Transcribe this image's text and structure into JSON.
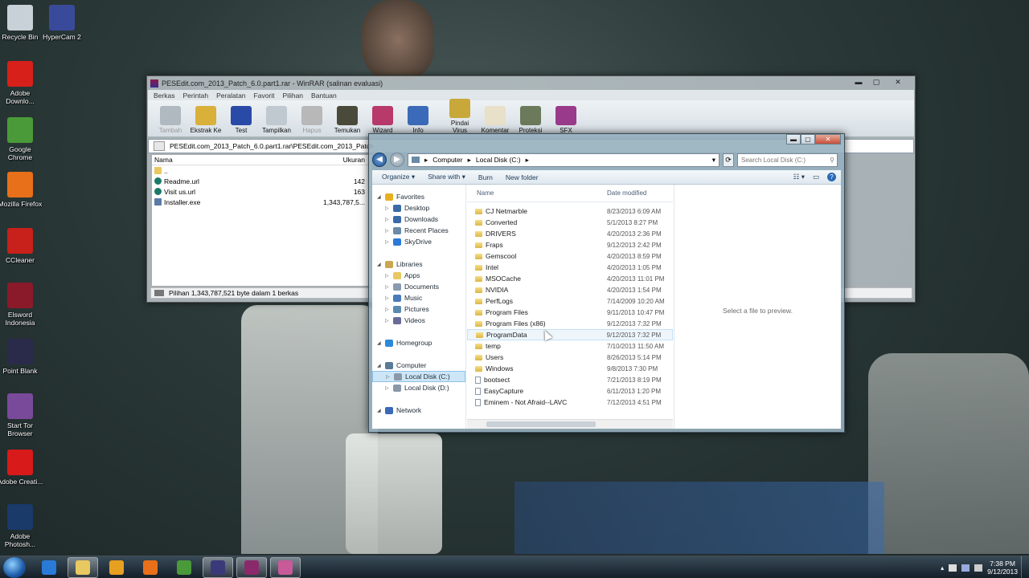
{
  "desktop": {
    "icons": [
      {
        "label": "Recycle Bin",
        "color": "#c8d0d8"
      },
      {
        "label": "HyperCam 2",
        "color": "#3a4a9a"
      },
      {
        "label": "Adobe Downlo...",
        "color": "#d8201a"
      },
      {
        "label": "Google Chrome",
        "color": "#4a9a3a"
      },
      {
        "label": "Mozilla Firefox",
        "color": "#e8701a"
      },
      {
        "label": "CCleaner",
        "color": "#c8201a"
      },
      {
        "label": "Elsword Indonesia",
        "color": "#8a1a2a"
      },
      {
        "label": "Point Blank",
        "color": "#2a2a4a"
      },
      {
        "label": "Start Tor Browser",
        "color": "#7a4a9a"
      },
      {
        "label": "Adobe Creati...",
        "color": "#d81a1a"
      },
      {
        "label": "Adobe Photosh...",
        "color": "#1a3a6a"
      }
    ]
  },
  "winrar": {
    "title": "PESEdit.com_2013_Patch_6.0.part1.rar - WinRAR (salinan evaluasi)",
    "menu": [
      "Berkas",
      "Perintah",
      "Peralatan",
      "Favorit",
      "Pilihan",
      "Bantuan"
    ],
    "toolbar": [
      {
        "label": "Tambah",
        "disabled": true,
        "icon": "add-archive-icon",
        "color": "#b0b8c0"
      },
      {
        "label": "Ekstrak Ke",
        "disabled": false,
        "icon": "extract-icon",
        "color": "#d8b03a"
      },
      {
        "label": "Test",
        "disabled": false,
        "icon": "test-icon",
        "color": "#2a4aa8"
      },
      {
        "label": "Tampilkan",
        "disabled": false,
        "icon": "view-icon",
        "color": "#c0c8d0"
      },
      {
        "label": "Hapus",
        "disabled": true,
        "icon": "delete-icon",
        "color": "#b8b8b8"
      },
      {
        "label": "Temukan",
        "disabled": false,
        "icon": "find-icon",
        "color": "#4a4a3a"
      },
      {
        "label": "Wizard",
        "disabled": false,
        "icon": "wizard-icon",
        "color": "#b83a6a"
      },
      {
        "label": "Info",
        "disabled": false,
        "icon": "info-icon",
        "color": "#3a6ab8"
      },
      {
        "label": "Pindai Virus",
        "disabled": false,
        "icon": "virus-scan-icon",
        "color": "#c8a83a"
      },
      {
        "label": "Komentar",
        "disabled": false,
        "icon": "comment-icon",
        "color": "#e8e0c8"
      },
      {
        "label": "Proteksi",
        "disabled": false,
        "icon": "protect-icon",
        "color": "#6a7a5a"
      },
      {
        "label": "SFX",
        "disabled": false,
        "icon": "sfx-icon",
        "color": "#9a3a8a"
      }
    ],
    "path": "PESEdit.com_2013_Patch_6.0.part1.rar\\PESEdit.com_2013_Patch",
    "columns": {
      "name": "Nama",
      "size": "Ukuran"
    },
    "files": [
      {
        "name": "..",
        "size": "",
        "icon": "folder-icon"
      },
      {
        "name": "Readme.url",
        "size": "142",
        "icon": "url-icon"
      },
      {
        "name": "Visit us.url",
        "size": "163",
        "icon": "url-icon"
      },
      {
        "name": "Installer.exe",
        "size": "1,343,787,5...",
        "icon": "exe-icon"
      }
    ],
    "status": "Pilihan 1,343,787,521 byte dalam 1 berkas"
  },
  "explorer": {
    "breadcrumb": [
      "Computer",
      "Local Disk (C:)"
    ],
    "search_placeholder": "Search Local Disk (C:)",
    "commands": [
      "Organize ▾",
      "Share with ▾",
      "Burn",
      "New folder"
    ],
    "nav": [
      {
        "label": "Favorites",
        "level": 0,
        "icon": "star-icon",
        "selected": false
      },
      {
        "label": "Desktop",
        "level": 1,
        "icon": "desktop-icon",
        "selected": false
      },
      {
        "label": "Downloads",
        "level": 1,
        "icon": "downloads-icon",
        "selected": false
      },
      {
        "label": "Recent Places",
        "level": 1,
        "icon": "recent-places-icon",
        "selected": false
      },
      {
        "label": "SkyDrive",
        "level": 1,
        "icon": "skydrive-icon",
        "selected": false
      },
      {
        "label": "",
        "level": -1
      },
      {
        "label": "Libraries",
        "level": 0,
        "icon": "libraries-icon",
        "selected": false
      },
      {
        "label": "Apps",
        "level": 1,
        "icon": "folder-icon",
        "selected": false
      },
      {
        "label": "Documents",
        "level": 1,
        "icon": "documents-icon",
        "selected": false
      },
      {
        "label": "Music",
        "level": 1,
        "icon": "music-icon",
        "selected": false
      },
      {
        "label": "Pictures",
        "level": 1,
        "icon": "pictures-icon",
        "selected": false
      },
      {
        "label": "Videos",
        "level": 1,
        "icon": "videos-icon",
        "selected": false
      },
      {
        "label": "",
        "level": -1
      },
      {
        "label": "Homegroup",
        "level": 0,
        "icon": "homegroup-icon",
        "selected": false
      },
      {
        "label": "",
        "level": -1
      },
      {
        "label": "Computer",
        "level": 0,
        "icon": "computer-icon",
        "selected": false
      },
      {
        "label": "Local Disk (C:)",
        "level": 1,
        "icon": "drive-icon",
        "selected": true
      },
      {
        "label": "Local Disk (D:)",
        "level": 1,
        "icon": "drive-icon",
        "selected": false
      },
      {
        "label": "",
        "level": -1
      },
      {
        "label": "Network",
        "level": 0,
        "icon": "network-icon",
        "selected": false
      }
    ],
    "columns": {
      "name": "Name",
      "date": "Date modified"
    },
    "files": [
      {
        "name": "CJ Netmarble",
        "date": "8/23/2013 6:09 AM",
        "type": "folder"
      },
      {
        "name": "Converted",
        "date": "5/1/2013 8:27 PM",
        "type": "folder"
      },
      {
        "name": "DRIVERS",
        "date": "4/20/2013 2:36 PM",
        "type": "folder"
      },
      {
        "name": "Fraps",
        "date": "9/12/2013 2:42 PM",
        "type": "folder"
      },
      {
        "name": "Gemscool",
        "date": "4/20/2013 8:59 PM",
        "type": "folder"
      },
      {
        "name": "Intel",
        "date": "4/20/2013 1:05 PM",
        "type": "folder"
      },
      {
        "name": "MSOCache",
        "date": "4/20/2013 11:01 PM",
        "type": "folder"
      },
      {
        "name": "NVIDIA",
        "date": "4/20/2013 1:54 PM",
        "type": "folder"
      },
      {
        "name": "PerfLogs",
        "date": "7/14/2009 10:20 AM",
        "type": "folder"
      },
      {
        "name": "Program Files",
        "date": "9/11/2013 10:47 PM",
        "type": "folder"
      },
      {
        "name": "Program Files (x86)",
        "date": "9/12/2013 7:32 PM",
        "type": "folder"
      },
      {
        "name": "ProgramData",
        "date": "9/12/2013 7:32 PM",
        "type": "folder",
        "hover": true
      },
      {
        "name": "temp",
        "date": "7/10/2013 11:50 AM",
        "type": "folder"
      },
      {
        "name": "Users",
        "date": "8/26/2013 5:14 PM",
        "type": "folder"
      },
      {
        "name": "Windows",
        "date": "9/8/2013 7:30 PM",
        "type": "folder"
      },
      {
        "name": "bootsect",
        "date": "7/21/2013 8:19 PM",
        "type": "file"
      },
      {
        "name": "EasyCapture",
        "date": "6/11/2013 1:20 PM",
        "type": "file"
      },
      {
        "name": "Eminem - Not Afraid--LAVC",
        "date": "7/12/2013 4:51 PM",
        "type": "file"
      }
    ],
    "preview_text": "Select a file to preview."
  },
  "taskbar": {
    "apps": [
      {
        "name": "internet-explorer",
        "color": "#2a7ad8",
        "active": false
      },
      {
        "name": "windows-explorer",
        "color": "#e8c860",
        "active": true
      },
      {
        "name": "media-player",
        "color": "#e8a020",
        "active": false
      },
      {
        "name": "firefox",
        "color": "#e8701a",
        "active": false
      },
      {
        "name": "chrome",
        "color": "#4a9a3a",
        "active": false
      },
      {
        "name": "hypercam",
        "color": "#3a3a7a",
        "active": true
      },
      {
        "name": "winrar",
        "color": "#8a2a6a",
        "active": true
      },
      {
        "name": "installer",
        "color": "#c85a9a",
        "active": true
      }
    ],
    "time": "7:38 PM",
    "date": "9/12/2013"
  }
}
